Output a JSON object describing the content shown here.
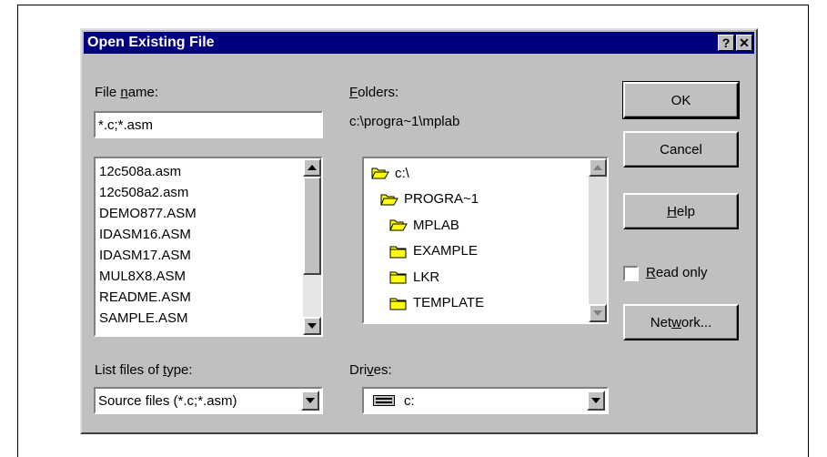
{
  "dialog": {
    "title": "Open Existing File",
    "help_glyph": "?",
    "close_glyph": "✕"
  },
  "file_name": {
    "label_pre": "File ",
    "label_key": "n",
    "label_post": "ame:",
    "value": "*.c;*.asm"
  },
  "files": [
    "12c508a.asm",
    "12c508a2.asm",
    "DEMO877.ASM",
    "IDASM16.ASM",
    "IDASM17.ASM",
    "MUL8X8.ASM",
    "README.ASM",
    "SAMPLE.ASM"
  ],
  "folders": {
    "label_key": "F",
    "label_post": "olders:",
    "current_path": "c:\\progra~1\\mplab",
    "tree": [
      {
        "name": "c:\\",
        "icon": "open-folder-icon"
      },
      {
        "name": "PROGRA~1",
        "icon": "open-folder-icon"
      },
      {
        "name": "MPLAB",
        "icon": "open-folder-icon"
      },
      {
        "name": "EXAMPLE",
        "icon": "closed-folder-icon"
      },
      {
        "name": "LKR",
        "icon": "closed-folder-icon"
      },
      {
        "name": "TEMPLATE",
        "icon": "closed-folder-icon"
      }
    ]
  },
  "file_type": {
    "label_pre": "List files of ",
    "label_key": "t",
    "label_post": "ype:",
    "value": "Source files (*.c;*.asm)"
  },
  "drives": {
    "label_pre": "Dri",
    "label_key": "v",
    "label_post": "es:",
    "value": "c:"
  },
  "buttons": {
    "ok": "OK",
    "cancel": "Cancel",
    "help_key": "H",
    "help_post": "elp",
    "network_pre": "Net",
    "network_key": "w",
    "network_post": "ork..."
  },
  "read_only": {
    "label_key": "R",
    "label_post": "ead only",
    "checked": false
  },
  "colors": {
    "titlebar": "#000080",
    "face": "#c0c0c0",
    "folder": "#ffff00"
  }
}
